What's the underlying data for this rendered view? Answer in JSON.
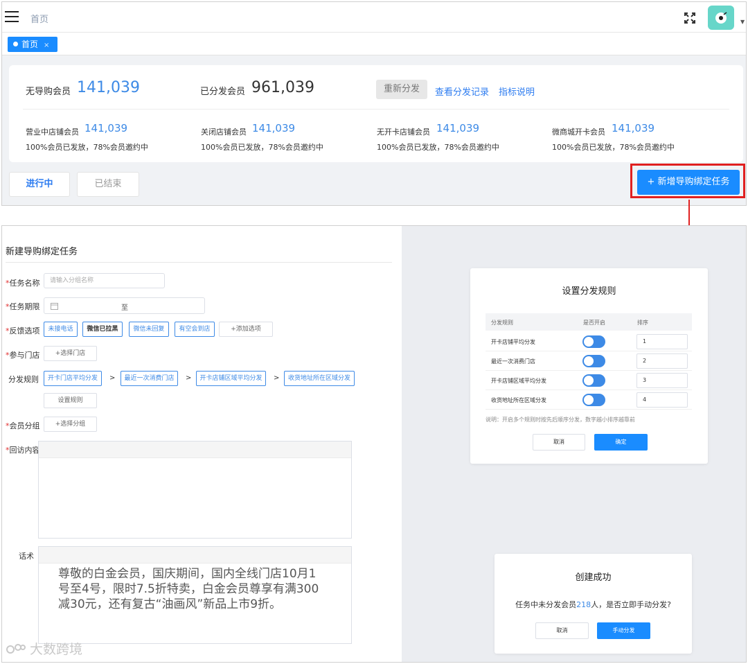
{
  "topbar": {
    "breadcrumb": "首页"
  },
  "tabs": [
    {
      "label": "首页",
      "close": "×"
    }
  ],
  "stats": {
    "no_guide_label": "无导购会员",
    "no_guide_value": "141,039",
    "distributed_label": "已分发会员",
    "distributed_value": "961,039",
    "redistribute_btn": "重新分发",
    "view_records_link": "查看分发记录",
    "metric_desc_link": "指标说明",
    "groups": [
      {
        "label": "营业中店铺会员",
        "value": "141,039",
        "note": "100%会员已发放，78%会员邀约中"
      },
      {
        "label": "关闭店铺会员",
        "value": "141,039",
        "note": "100%会员已发放，78%会员邀约中"
      },
      {
        "label": "无开卡店铺会员",
        "value": "141,039",
        "note": "100%会员已发放，78%会员邀约中"
      },
      {
        "label": "微商城开卡会员",
        "value": "141,039",
        "note": "100%会员已发放，78%会员邀约中"
      }
    ]
  },
  "filter_tabs": {
    "in_progress": "进行中",
    "ended": "已结束"
  },
  "add_task_btn": "+ 新增导购绑定任务",
  "form": {
    "title": "新建导购绑定任务",
    "req": "*",
    "task_name_label": "任务名称",
    "task_name_placeholder": "请输入分组名称",
    "period_label": "任务期限",
    "period_to": "至",
    "feedback_label": "反馈选项",
    "feedback_options": [
      "未接电话",
      "微信已拉黑",
      "微信未回复",
      "有空会到店"
    ],
    "add_option": "+添加选项",
    "stores_label": "参与门店",
    "select_store": "+选择门店",
    "rules_label": "分发规则",
    "rule_chain": [
      "开卡门店平均分发",
      "最近一次消费门店",
      "开卡店铺区域平均分发",
      "收货地址所在区域分发"
    ],
    "rule_sep": ">",
    "set_rules": "设置规则",
    "group_label": "会员分组",
    "select_group": "+选择分组",
    "visit_label": "回访内容",
    "script_label": "话术",
    "script_text": "尊敬的白金会员，国庆期间，国内全线门店10月1号至4号，限时7.5折特卖，白金会员尊享有满300减30元，还有复古“油画风”新品上市9折。"
  },
  "watermark": "大数跨境",
  "rules_dialog": {
    "title": "设置分发规则",
    "col_rule": "分发规则",
    "col_enabled": "是否开启",
    "col_rank": "排序",
    "rows": [
      {
        "name": "开卡店铺平均分发",
        "rank": "1",
        "enabled": true
      },
      {
        "name": "最近一次消费门店",
        "rank": "2",
        "enabled": true
      },
      {
        "name": "开卡店铺区域平均分发",
        "rank": "3",
        "enabled": true
      },
      {
        "name": "收货地址所在区域分发",
        "rank": "4",
        "enabled": true
      }
    ],
    "note": "说明：开启多个规则时按先后顺序分发，数字越小排序越靠前",
    "cancel": "取消",
    "confirm": "确定"
  },
  "success_dialog": {
    "title": "创建成功",
    "msg_pre": "任务中未分发会员",
    "count": "218",
    "msg_post": "人，是否立即手动分发?",
    "cancel": "取消",
    "manual": "手动分发"
  },
  "colors": {
    "primary": "#1a8cff",
    "accent_blue": "#3d8ae6",
    "highlight_red": "#e02020",
    "avatar_bg": "#67d6c9"
  }
}
